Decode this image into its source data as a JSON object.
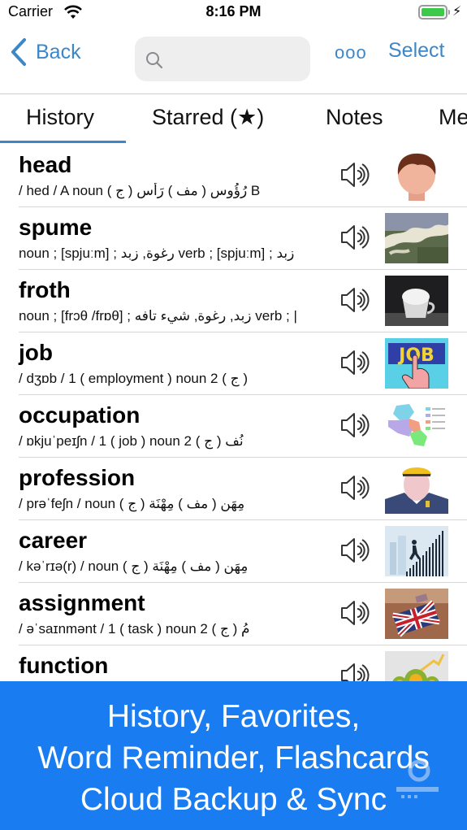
{
  "status_bar": {
    "carrier": "Carrier",
    "time": "8:16 PM",
    "battery_level": 1.0,
    "charging": true
  },
  "nav_bar": {
    "back_label": "Back",
    "search_placeholder": "",
    "search_value": "",
    "more_label": "ooo",
    "select_label": "Select"
  },
  "tabs": [
    {
      "label": "History",
      "selected": true
    },
    {
      "label": "Starred (★)",
      "selected": false
    },
    {
      "label": "Notes",
      "selected": false
    },
    {
      "label": "Me",
      "selected": false
    }
  ],
  "colors": {
    "accent": "#3c87c8",
    "banner": "#1a7cf1",
    "battery": "#3fc94c"
  },
  "entries": [
    {
      "word": "head",
      "definition": "/ hed /   A   noun   ( ج )  رُؤُوس  ( مف )  رَأس B",
      "image": "head-avatar"
    },
    {
      "word": "spume",
      "definition": "noun ; [spjuːm] ; رغوة, زبد verb ; [spjuːm] ; زبد",
      "image": "foam-on-rocks"
    },
    {
      "word": "froth",
      "definition": "noun ; [frɔθ /frɒθ] ; زبد, رغوة, شيء تافه verb ; |",
      "image": "cup-with-froth"
    },
    {
      "word": "job",
      "definition": "/ dʒɒb /   1   ( employment )   noun   2   ( ج )",
      "image": "job-sign"
    },
    {
      "word": "occupation",
      "definition": "/ ɒkjuˈpeɪʃn /   1   ( job )   noun   2   ( ج )  نُف",
      "image": "occupation-map"
    },
    {
      "word": "profession",
      "definition": "/ prəˈfeʃn /   noun   ( ج )  مِهَن  ( مف )  مِهْنَة",
      "image": "worker-avatar"
    },
    {
      "word": "career",
      "definition": "/ kəˈrɪə(r) /   noun   ( ج )  مِهَن  ( مف )  مِهْنَة",
      "image": "career-chart"
    },
    {
      "word": "assignment",
      "definition": "/ əˈsaɪnmənt /   1   ( task )   noun   2   ( ج )  مُ",
      "image": "flag-puzzle"
    },
    {
      "word": "function",
      "definition": "",
      "image": "gears"
    }
  ],
  "banner": {
    "lines": [
      "History, Favorites,",
      "Word Reminder, Flashcards",
      "Cloud Backup & Sync"
    ]
  }
}
